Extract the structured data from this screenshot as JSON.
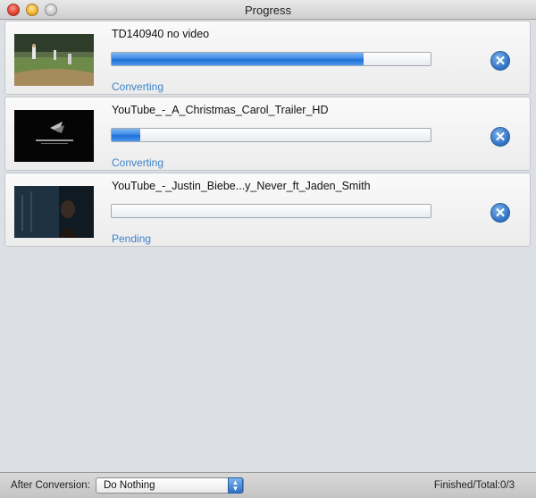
{
  "window": {
    "title": "Progress"
  },
  "items": [
    {
      "name": "TD140940 no video",
      "progress": 0.79,
      "status": "Converting",
      "thumbnail": "baseball-field-thumbnail"
    },
    {
      "name": "YouTube_-_A_Christmas_Carol_Trailer_HD",
      "progress": 0.09,
      "status": "Converting",
      "thumbnail": "studio-logo-thumbnail"
    },
    {
      "name": "YouTube_-_Justin_Biebe...y_Never_ft_Jaden_Smith",
      "progress": 0.0,
      "status": "Pending",
      "thumbnail": "dark-scene-thumbnail"
    }
  ],
  "footer": {
    "after_label": "After Conversion:",
    "after_value": "Do Nothing",
    "finished_text": "Finished/Total:0/3"
  },
  "colors": {
    "progress": "#2f7fe0",
    "status": "#3f83c9"
  }
}
